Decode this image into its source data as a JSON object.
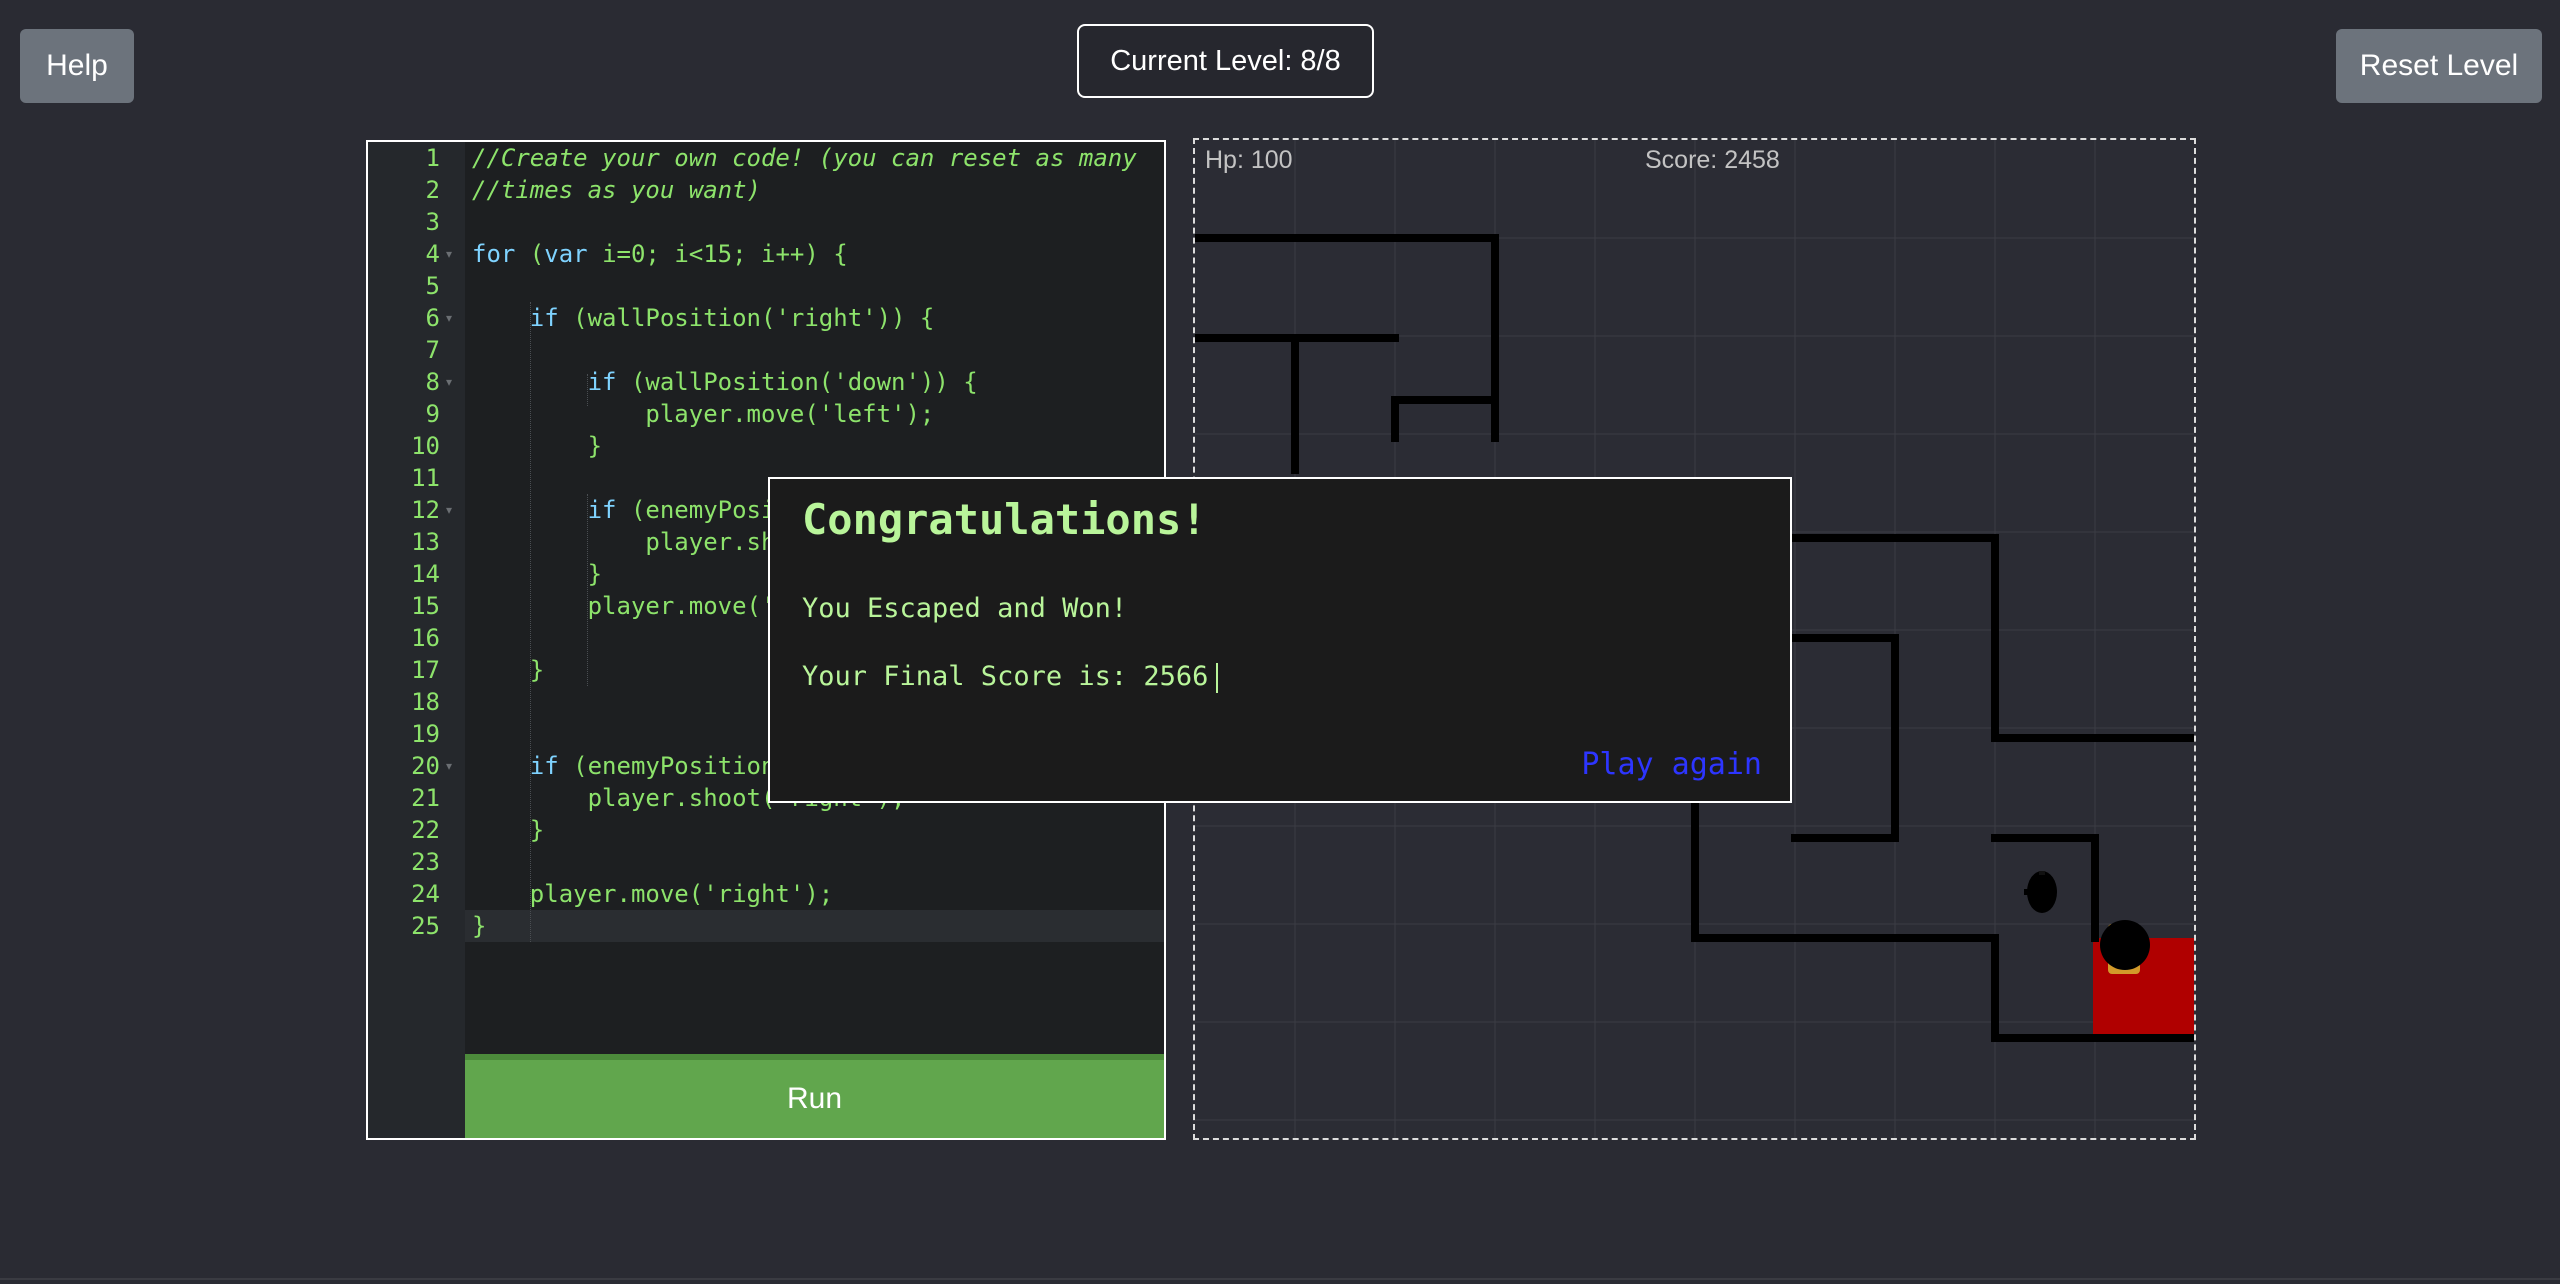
{
  "header": {
    "help_label": "Help",
    "level_label": "Current Level: 8/8",
    "reset_label": "Reset Level"
  },
  "editor": {
    "lines": [
      "//Create your own code! (you can reset as many",
      "//times as you want)",
      "",
      "for (var i=0; i<15; i++) {",
      "",
      "    if (wallPosition('right')) {",
      "",
      "        if (wallPosition('down')) {",
      "            player.move('left');",
      "        }",
      "",
      "        if (enemyPosi",
      "            player.sh",
      "        }",
      "        player.move('",
      "",
      "    }",
      "",
      "",
      "    if (enemyPosition",
      "        player.shoot('right');",
      "    }",
      "",
      "    player.move('right');",
      "}"
    ],
    "run_label": "Run"
  },
  "game": {
    "hp_label": "Hp: 100",
    "score_label": "Score: 2458",
    "colors": {
      "background": "#2b2c34",
      "wall": "#000000",
      "exit": "#b00000",
      "grid": "#3b3c44"
    }
  },
  "modal": {
    "title": "Congratulations!",
    "line1": "You Escaped and Won!",
    "line2": "Your Final Score is: 2566",
    "play_again_label": "Play again"
  }
}
